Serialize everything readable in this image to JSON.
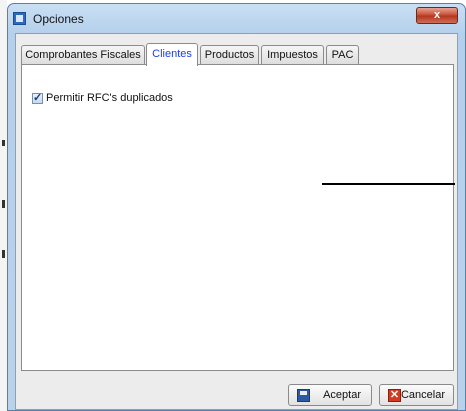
{
  "window": {
    "title": "Opciones",
    "close_label": "x"
  },
  "tabs": [
    {
      "label": "Comprobantes Fiscales",
      "active": false
    },
    {
      "label": "Clientes",
      "active": true
    },
    {
      "label": "Productos",
      "active": false
    },
    {
      "label": "Impuestos",
      "active": false
    },
    {
      "label": "PAC",
      "active": false
    }
  ],
  "clientes": {
    "allow_duplicate_rfc": {
      "label": "Permitir RFC's duplicados",
      "checked": true
    }
  },
  "buttons": {
    "accept_label": "Aceptar",
    "cancel_label": "Cancelar"
  },
  "icons": {
    "app": "window-app-icon",
    "accept": "save-disk-icon",
    "cancel": "cancel-x-icon"
  },
  "colors": {
    "active_tab_text": "#1b3fe6",
    "title_bar": "#b9d2ec",
    "close_button": "#c7482f"
  }
}
